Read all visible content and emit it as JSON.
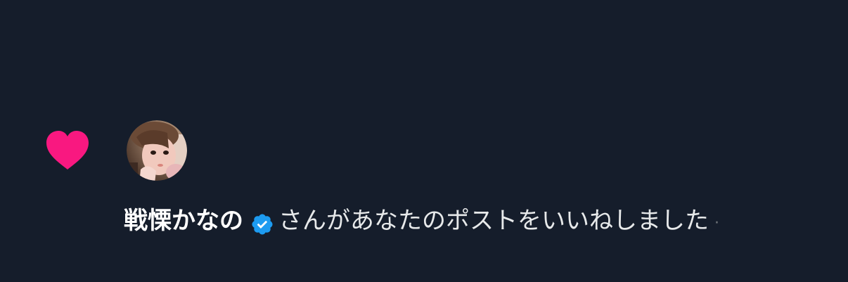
{
  "notification": {
    "type_icon": "heart-icon",
    "user": {
      "avatar": "user-avatar-photo",
      "display_name": "戦慄かなの",
      "verified_icon": "verified-badge-icon"
    },
    "message": "さんがあなたのポストをいいねしました",
    "separator": "·"
  },
  "colors": {
    "background": "#151d2b",
    "heart": "#f91880",
    "verified": "#1d9bf0",
    "text": "#e7e9ea"
  }
}
